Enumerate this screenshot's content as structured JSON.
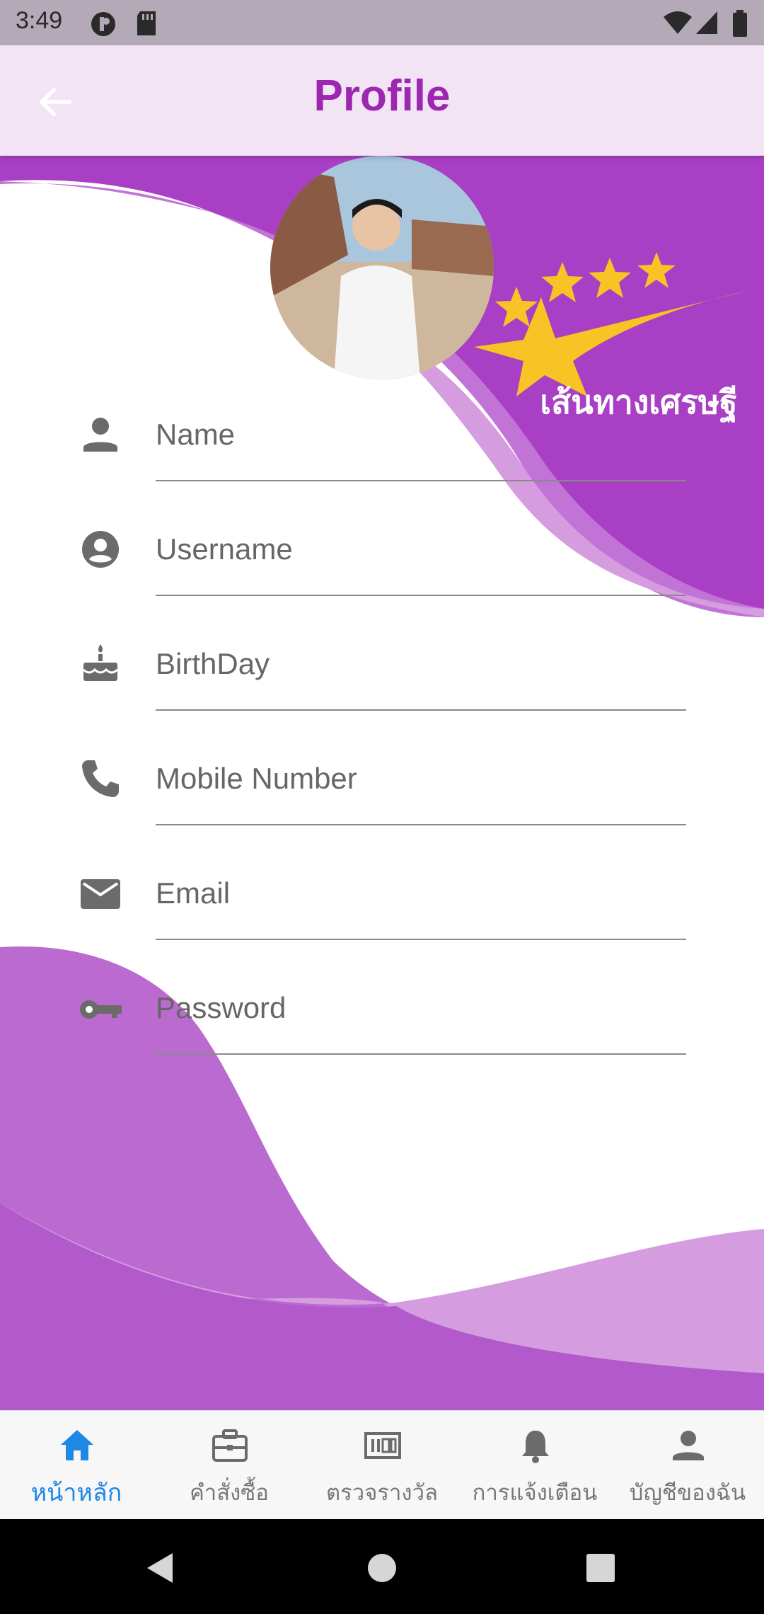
{
  "status_bar": {
    "time": "3:49"
  },
  "app_bar": {
    "title": "Profile",
    "title_color": "#9c27b0"
  },
  "logo": {
    "text": "เส้นทางเศรษฐี",
    "star_color": "#f7c325"
  },
  "form": {
    "fields": [
      {
        "icon": "person-icon",
        "label": "Name"
      },
      {
        "icon": "account-circle-icon",
        "label": "Username"
      },
      {
        "icon": "cake-icon",
        "label": "BirthDay"
      },
      {
        "icon": "phone-icon",
        "label": "Mobile Number"
      },
      {
        "icon": "email-icon",
        "label": "Email"
      },
      {
        "icon": "key-icon",
        "label": "Password"
      }
    ]
  },
  "bottom_nav": {
    "active_color": "#1e88e5",
    "items": [
      {
        "icon": "home-icon",
        "label": "หน้าหลัก",
        "active": true
      },
      {
        "icon": "briefcase-icon",
        "label": "คำสั่งซื้อ",
        "active": false
      },
      {
        "icon": "ticket-icon",
        "label": "ตรวจรางวัล",
        "active": false
      },
      {
        "icon": "bell-icon",
        "label": "การแจ้งเตือน",
        "active": false
      },
      {
        "icon": "account-icon",
        "label": "บัญชีของฉัน",
        "active": false
      }
    ]
  },
  "colors": {
    "purple_dark": "#a93fc4",
    "purple_mid": "#bb6acf",
    "purple_light": "#d59de0"
  }
}
